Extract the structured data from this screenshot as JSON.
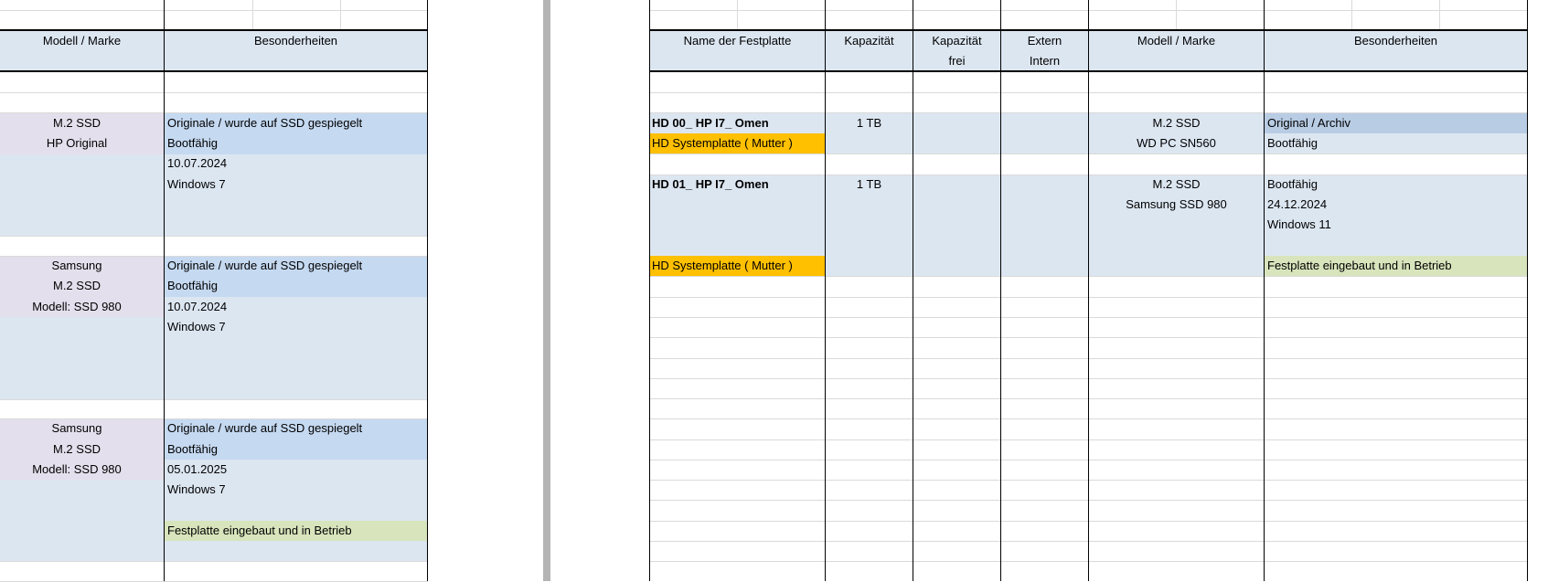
{
  "colors": {
    "header_fill": "#dce6f1",
    "row_fill": "#dce6f1",
    "highlight_blue": "#c5d9f1",
    "highlight_blue_dark": "#b8cce4",
    "highlight_lavender": "#e4dfec",
    "highlight_orange": "#ffc000",
    "highlight_green": "#d8e4bc",
    "grid_line": "#dadada",
    "border_dark": "#000000",
    "splitter": "#b4b4b4"
  },
  "left_pane": {
    "headers": {
      "model": "Modell / Marke",
      "features": "Besonderheiten"
    },
    "disks": [
      {
        "model_lines": [
          "M.2 SSD",
          "HP Original"
        ],
        "feature_lines": [
          "Originale / wurde auf SSD gespiegelt",
          "Bootfähig",
          "10.07.2024",
          "Windows 7"
        ]
      },
      {
        "model_lines": [
          "Samsung",
          "M.2 SSD",
          "Modell: SSD 980"
        ],
        "feature_lines": [
          "Originale / wurde auf SSD gespiegelt",
          "Bootfähig",
          "10.07.2024",
          "Windows 7"
        ]
      },
      {
        "model_lines": [
          "Samsung",
          "M.2 SSD",
          "Modell: SSD 980"
        ],
        "feature_lines": [
          "Originale / wurde auf SSD gespiegelt",
          "Bootfähig",
          "05.01.2025",
          "Windows 7",
          "",
          "Festplatte eingebaut und in Betrieb"
        ]
      }
    ]
  },
  "right_pane": {
    "headers": {
      "name": "Name der Festplatte",
      "capacity": "Kapazität",
      "capacity_free_l1": "Kapazität",
      "capacity_free_l2": "frei",
      "location_l1": "Extern",
      "location_l2": "Intern",
      "model": "Modell / Marke",
      "features": "Besonderheiten"
    },
    "disks": [
      {
        "name": "HD 00_ HP I7_ Omen",
        "role": "HD Systemplatte ( Mutter )",
        "capacity": "1 TB",
        "model_lines": [
          "M.2 SSD",
          "WD PC SN560"
        ],
        "feature_lines": [
          "Original / Archiv",
          "Bootfähig"
        ]
      },
      {
        "name": "HD 01_ HP I7_ Omen",
        "role": "HD Systemplatte ( Mutter )",
        "capacity": "1 TB",
        "model_lines": [
          "M.2 SSD",
          "Samsung SSD 980"
        ],
        "feature_lines": [
          "Bootfähig",
          "24.12.2024",
          "Windows 11",
          "Festplatte eingebaut und in Betrieb"
        ]
      }
    ]
  }
}
